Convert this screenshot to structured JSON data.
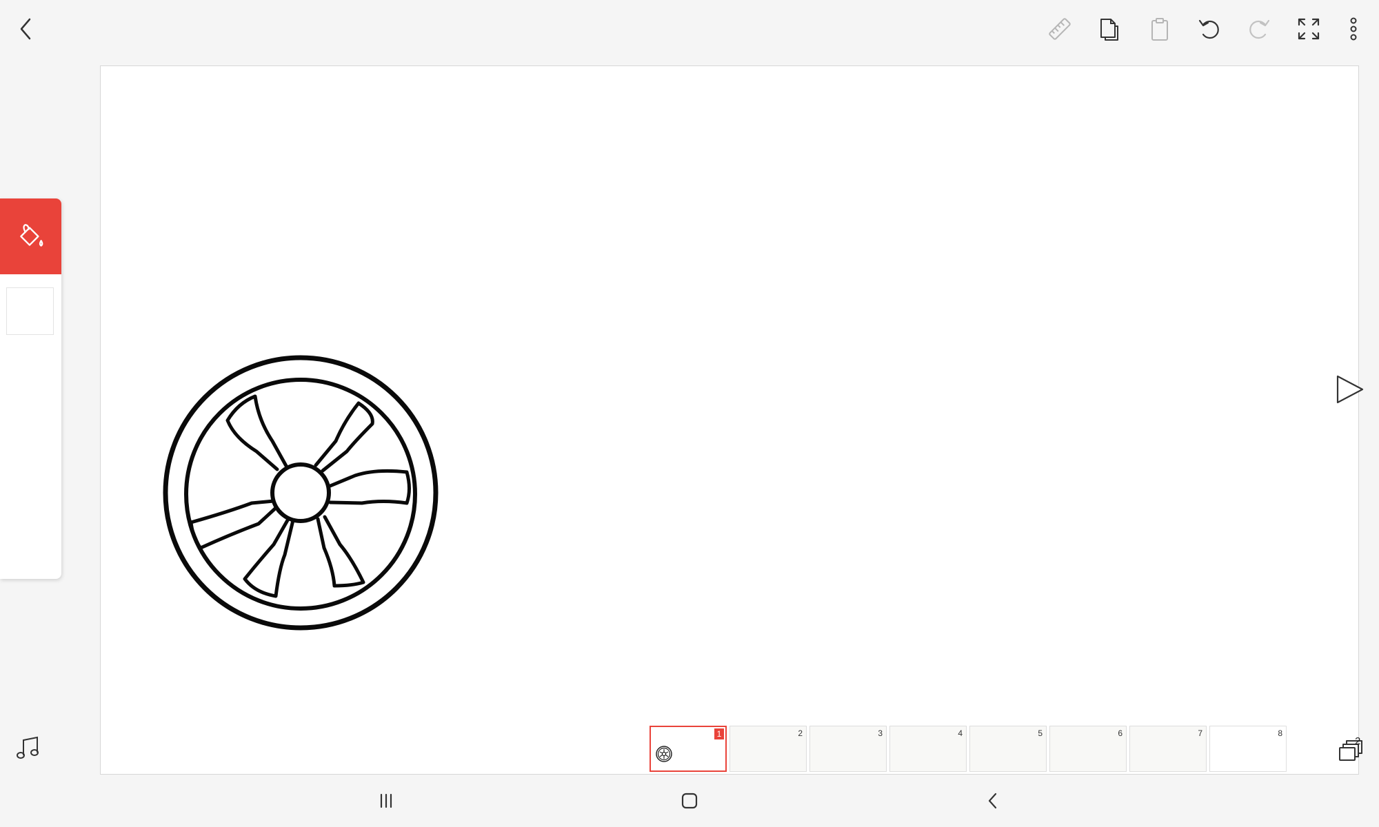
{
  "toolbar": {
    "back": "back-arrow",
    "tools": [
      "ruler",
      "copy-frame",
      "paste-frame",
      "undo",
      "redo",
      "fullscreen",
      "more"
    ]
  },
  "side_panel": {
    "active_tool": "fill-bucket",
    "accent_color": "#e9433a",
    "selected_color": "#ffffff"
  },
  "timeline": {
    "frames": [
      {
        "number": "1",
        "active": true
      },
      {
        "number": "2"
      },
      {
        "number": "3"
      },
      {
        "number": "4"
      },
      {
        "number": "5"
      },
      {
        "number": "6"
      },
      {
        "number": "7"
      },
      {
        "number": "8"
      }
    ],
    "layers_count": "2"
  },
  "colors": {
    "accent": "#e9433a",
    "background": "#f5f5f5",
    "canvas": "#ffffff"
  },
  "navbar": [
    "recent-apps",
    "home",
    "back"
  ]
}
